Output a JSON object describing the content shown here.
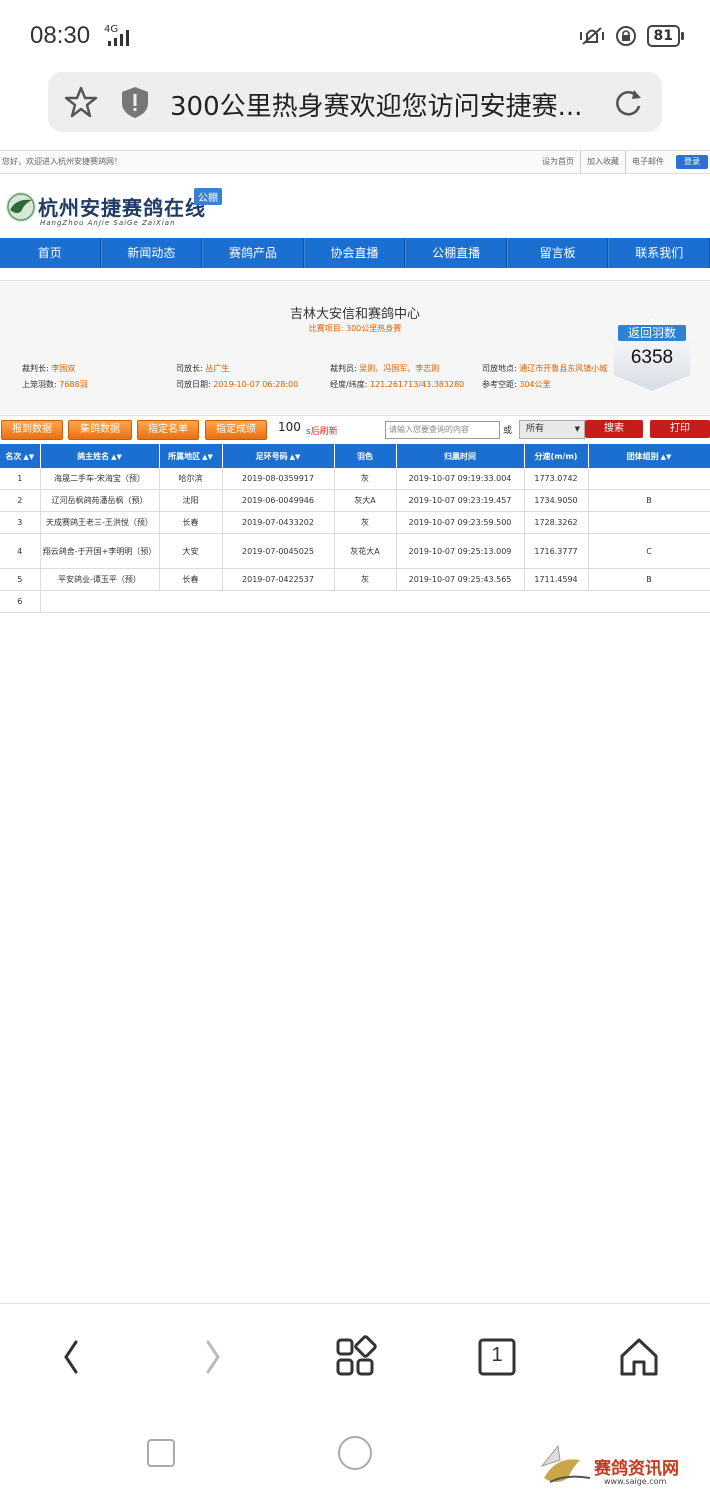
{
  "status_bar": {
    "time": "08:30",
    "network": "4G",
    "battery": "81"
  },
  "url_bar": {
    "title": "300公里热身赛欢迎您访问安捷赛..."
  },
  "site": {
    "welcome": "您好，欢迎进入杭州安捷赛鸽网！",
    "top_links": [
      "设为首页",
      "加入收藏",
      "电子邮件"
    ],
    "login": "登录",
    "logo_text": "杭州安捷赛鸽在线",
    "logo_sub": "HangZhou AnJie SaiGe ZaiXian",
    "logo_badge": "公棚",
    "nav": [
      "首页",
      "新闻动态",
      "赛鸽产品",
      "协会直播",
      "公棚直播",
      "留言板",
      "联系我们"
    ]
  },
  "info": {
    "venue": "吉林大安信和赛鸽中心",
    "race_label": "比赛项目:",
    "race_value": "300公里热身赛",
    "referee_chief_label": "裁判长:",
    "referee_chief": "李国双",
    "release_chief_label": "司放长:",
    "release_chief": "丛广生",
    "referees_label": "裁判员:",
    "referees": "吴刚、冯国军、李志刚",
    "release_place_label": "司放地点:",
    "release_place": "通辽市开鲁县东风镇小城",
    "entered_label": "上笼羽数:",
    "entered": "7688羽",
    "release_date_label": "司放日期:",
    "release_date": "2019-10-07 06:28:00",
    "coords_label": "经度/纬度:",
    "coords": "121.261713/43.383280",
    "distance_label": "参考空距:",
    "distance": "304公里",
    "return_label": "返回羽数",
    "return_count": "6358"
  },
  "toolbar": {
    "buttons": [
      "报到数据",
      "集鸽数据",
      "指定名单",
      "指定成绩"
    ],
    "refresh_seconds": "100",
    "refresh_text": "s后刷新",
    "search_placeholder": "请输入您要查询的内容",
    "or_text": "或",
    "select_value": "所有",
    "search_btn": "搜索",
    "print_btn": "打印"
  },
  "table": {
    "headers": [
      "名次",
      "鸽主姓名",
      "所属地区",
      "足环号码",
      "羽色",
      "归巢时间",
      "分速(m/m)",
      "团体组别"
    ],
    "rows": [
      [
        "1",
        "海晟二手车-宋海宝（预）",
        "哈尔滨",
        "2019-08-0359917",
        "灰",
        "2019-10-07 09:19:33.004",
        "1773.0742",
        ""
      ],
      [
        "2",
        "辽河岳枫鸽苑潘岳枫（预）",
        "沈阳",
        "2019-06-0049946",
        "灰大A",
        "2019-10-07 09:23:19.457",
        "1734.9050",
        "B"
      ],
      [
        "3",
        "天成赛鸽王老三-王洪悦（预）",
        "长春",
        "2019-07-0433202",
        "灰",
        "2019-10-07 09:23:59.500",
        "1728.3262",
        ""
      ],
      [
        "4",
        "翔云鸽舍-于开国+李明明（预）",
        "大安",
        "2019-07-0045025",
        "灰花大A",
        "2019-10-07 09:25:13.009",
        "1716.3777",
        "C"
      ],
      [
        "5",
        "平安鸽业-谭玉平（预）",
        "长春",
        "2019-07-0422537",
        "灰",
        "2019-10-07 09:25:43.565",
        "1711.4594",
        "B"
      ],
      [
        "6",
        "",
        "",
        "",
        "",
        "",
        "",
        ""
      ]
    ]
  },
  "browser_nav": {
    "tab_count": "1"
  },
  "watermark": {
    "text": "赛鸽资讯网",
    "url": "www.saige.com"
  }
}
